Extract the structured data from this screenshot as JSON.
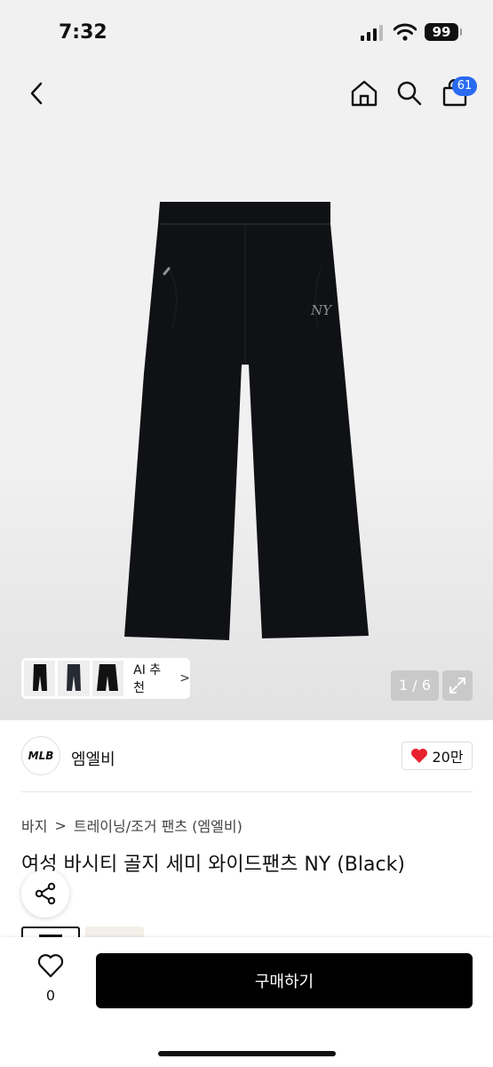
{
  "status_bar": {
    "time": "7:32",
    "battery": "99"
  },
  "header": {
    "cart_count": "61"
  },
  "gallery": {
    "counter": "1 / 6",
    "ai_label": "AI 추천",
    "ai_chevron": ">"
  },
  "brand": {
    "logo_text": "MLB",
    "name": "엠엘비",
    "likes": "20만"
  },
  "breadcrumb": {
    "category": "바지",
    "separator": ">",
    "subcategory": "트레이닝/조거 팬츠 (엠엘비)"
  },
  "product": {
    "title": "여성 바시티 골지 세미 와이드팬츠 NY (Black)",
    "garment_color": "#101114"
  },
  "bottom_bar": {
    "wish_count": "0",
    "buy_label": "구매하기"
  },
  "colors": {
    "accent_badge": "#2a6af0",
    "buy_button": "#000000",
    "heart": "#e8202e"
  }
}
